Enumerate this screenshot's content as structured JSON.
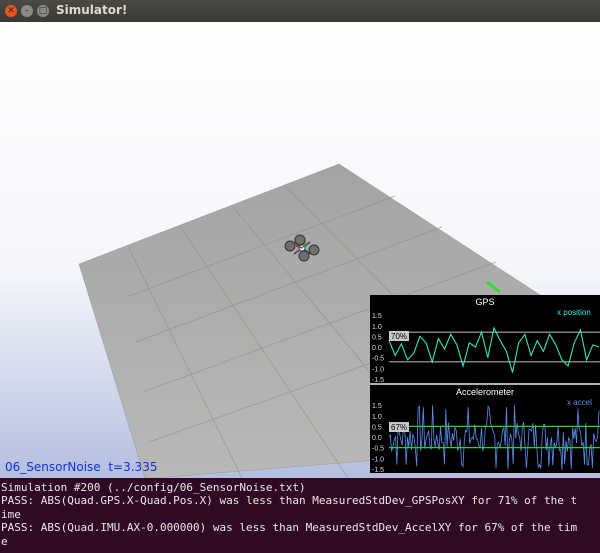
{
  "window": {
    "title": "Simulator!"
  },
  "scene": {
    "sim_label_name": "06_SensorNoise",
    "sim_label_time": "t=3.335"
  },
  "plots": {
    "gps": {
      "title": "GPS",
      "series_label": "x position",
      "threshold_badge": "70%",
      "yticks": [
        "1.5",
        "1.0",
        "0.5",
        "0.0",
        "-0.5",
        "-1.0",
        "-1.5"
      ],
      "ylim": [
        -1.6,
        1.6
      ],
      "band": [
        -0.7,
        0.7
      ],
      "line_color": "#2ee8b8",
      "values": [
        0.3,
        -0.4,
        0.15,
        -0.6,
        -0.3,
        0.5,
        0.2,
        -0.7,
        0.4,
        -0.1,
        0.6,
        0.1,
        -0.9,
        0.2,
        0.0,
        0.7,
        -0.5,
        0.9,
        0.3,
        -0.2,
        -1.2,
        0.2,
        0.6,
        -0.4,
        0.3,
        -0.2,
        0.6,
        0.1,
        -0.6,
        -0.9,
        0.2,
        0.8,
        -0.6,
        0.1,
        0.0
      ]
    },
    "accel": {
      "title": "Accelerometer",
      "series_label": "x accel",
      "threshold_badge": "67%",
      "yticks": [
        "1.5",
        "1.0",
        "0.5",
        "0.0",
        "-0.5",
        "-1.0",
        "-1.5"
      ],
      "ylim": [
        -1.6,
        1.6
      ],
      "band": [
        0.5,
        -0.5
      ],
      "line_color": "#5b8ef0"
    }
  },
  "console": {
    "lines": [
      "Simulation #200 (../config/06_SensorNoise.txt)",
      "PASS: ABS(Quad.GPS.X-Quad.Pos.X) was less than MeasuredStdDev_GPSPosXY for 71% of the t",
      "ime",
      "PASS: ABS(Quad.IMU.AX-0.000000) was less than MeasuredStdDev_AccelXY for 67% of the tim",
      "e"
    ]
  },
  "colors": {
    "titlebar": "#3c3b37",
    "console_bg": "#300a24",
    "close_button": "#e95420"
  }
}
